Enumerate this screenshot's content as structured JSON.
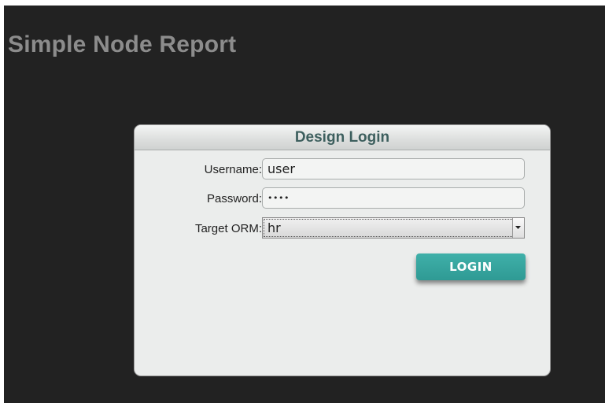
{
  "app": {
    "title": "Simple Node Report"
  },
  "login_dialog": {
    "title": "Design Login",
    "username": {
      "label": "Username:",
      "value": "user"
    },
    "password": {
      "label": "Password:",
      "masked_value": "••••"
    },
    "target_orm": {
      "label": "Target ORM:",
      "selected": "hr"
    },
    "login_button_label": "LOGIN"
  },
  "colors": {
    "background": "#222222",
    "title_text": "#8c8c8c",
    "dialog_background": "#ebedec",
    "dialog_title_text": "#3d5f5e",
    "login_button": "#35a59f"
  },
  "icons": {
    "select_arrow": "chevron-down-icon"
  }
}
